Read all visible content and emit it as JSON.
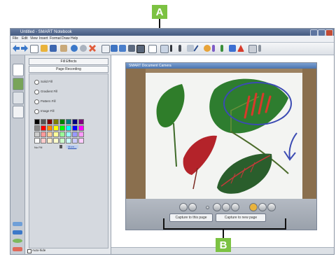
{
  "callouts": {
    "a": "A",
    "b": "B"
  },
  "window": {
    "title": "Untitled - SMART Notebook"
  },
  "menu": [
    "File",
    "Edit",
    "View",
    "Insert",
    "Format",
    "Draw",
    "Help"
  ],
  "panel": {
    "title": "Fill Effects",
    "transparency_button": "Page Recording",
    "fill_options": [
      "Solid Fill",
      "Gradient Fill",
      "Pattern Fill",
      "Image Fill"
    ],
    "custom_value": "No Fill",
    "more_link": "More...",
    "auto_hide": "Auto-hide"
  },
  "camera": {
    "title": "SMART Document Camera",
    "capture_to_page": "Capture to this page",
    "capture_to_new_page": "Capture to new page"
  },
  "colors": {
    "accent_green": "#7cc242",
    "titlebar": "#445a80",
    "leaf_green": "#2f7d2a",
    "leaf_red": "#b4232a",
    "annotation_blue": "#3b4bb3",
    "annotation_red": "#d83a2a"
  },
  "icons": {
    "toolbar": [
      "back-icon",
      "forward-icon",
      "add-page-icon",
      "open-icon",
      "save-icon",
      "paste-icon",
      "undo-icon",
      "redo-icon",
      "delete-icon",
      "screen-shade-icon",
      "display-icon",
      "camera-icon",
      "table-icon",
      "select-icon",
      "pen-icon",
      "marker-icon",
      "eraser-icon",
      "line-icon",
      "shape-icon",
      "fill-icon",
      "text-icon",
      "properties-icon"
    ]
  }
}
